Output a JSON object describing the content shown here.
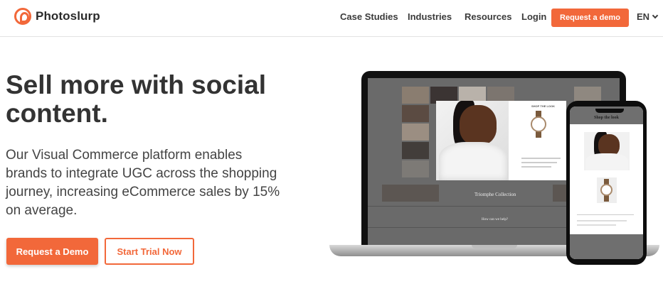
{
  "brand": {
    "name": "Photoslurp",
    "accent": "#f2683a"
  },
  "nav": {
    "items": [
      "Case Studies",
      "Industries",
      "Resources",
      "Login"
    ],
    "cta": "Request a demo",
    "language": "EN"
  },
  "hero": {
    "title": "Sell more with social content.",
    "subtitle": "Our Visual Commerce platform enables brands to integrate UGC across the shopping journey, increasing eCommerce sales by 15% on average.",
    "primary_button": "Request a Demo",
    "secondary_button": "Start Trial Now"
  },
  "laptop_screen": {
    "modal_heading": "SHOP THE LOOK",
    "collection_title": "Triomphe Collection",
    "help_title": "How can we help?"
  },
  "phone_screen": {
    "heading": "Shop the look"
  },
  "icons": [
    "logo-mark-icon",
    "chevron-down-icon"
  ]
}
